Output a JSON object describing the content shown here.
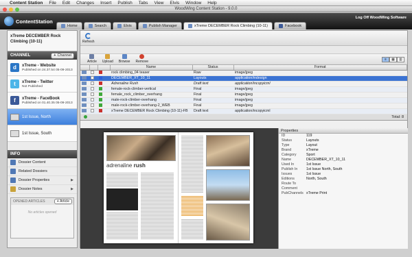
{
  "menubar": {
    "app": "Content Station",
    "items": [
      "File",
      "Edit",
      "Changes",
      "Insert",
      "Publish",
      "Tabs",
      "View",
      "Elvis",
      "Window",
      "Help"
    ]
  },
  "window": {
    "title": "WoodWing Content Station - 9.0.0"
  },
  "header": {
    "logo_text": "ContentStation",
    "logoff": "Log Off WoodWing Software",
    "tabs": [
      {
        "label": "Home"
      },
      {
        "label": "Search"
      },
      {
        "label": "Elvis"
      },
      {
        "label": "Publish Manager"
      },
      {
        "label": "xTreme DECEMBER Rock Climbing (10-11)"
      },
      {
        "label": "Facebook"
      }
    ]
  },
  "sidebar": {
    "dossier_title": "xTreme DECEMBER Rock Climbing (10-11)",
    "channel_header": "CHANNEL",
    "channel_button": "Channel",
    "channels": [
      {
        "name": "xTreme - Website",
        "status": "Published on 24.37.54 05-09-2013",
        "icon": "drupal-icon",
        "color": "#2a76c6"
      },
      {
        "name": "xTreme - Twitter",
        "status": "Not Published",
        "icon": "twitter-icon",
        "color": "#4cb5e8"
      },
      {
        "name": "xTreme - FaceBook",
        "status": "Published on 01.40.35 05-09-2013",
        "icon": "facebook-icon",
        "color": "#3b5998"
      }
    ],
    "issues": [
      {
        "name": "1st Issue, North"
      },
      {
        "name": "1st Issue, South"
      }
    ],
    "info_header": "INFO",
    "info_items": [
      {
        "label": "Dossier Content",
        "has_arrow": false
      },
      {
        "label": "Related Dossiers",
        "has_arrow": false
      },
      {
        "label": "Dossier Properties",
        "has_arrow": true
      },
      {
        "label": "Dossier Notes",
        "has_arrow": true
      }
    ],
    "opened_articles": {
      "label": "OPENED ARTICLES",
      "button": "Article",
      "empty": "No articles opened"
    }
  },
  "toolbar": {
    "refresh": "Refresh",
    "buttons": [
      {
        "label": "Article",
        "color": "#6d7fa5"
      },
      {
        "label": "Upload",
        "color": "#d9a43a"
      },
      {
        "label": "Browse",
        "color": "#5c86c6"
      },
      {
        "label": "Remove",
        "color": "#d1422f"
      }
    ]
  },
  "table": {
    "columns": [
      "Name",
      "Status",
      "Format"
    ],
    "rows": [
      {
        "name": "rock climbing_04 teaser",
        "status": "Raw",
        "format": "image/jpeg",
        "color": "#c9302c",
        "selected": false,
        "draft": false
      },
      {
        "name": "DECEMBER_XT_10_11",
        "status": "Layouts",
        "format": "application/indesign",
        "color": "#2f62d8",
        "selected": true,
        "draft": false
      },
      {
        "name": "Adrenaline Rush",
        "status": "Draft text",
        "format": "application/incopyicml",
        "color": "#c9302c",
        "selected": false,
        "draft": true
      },
      {
        "name": "female-rock-climber-vertical",
        "status": "Final",
        "format": "image/jpeg",
        "color": "#3ea83a",
        "selected": false,
        "draft": false
      },
      {
        "name": "female_rock_climber_overhang",
        "status": "Final",
        "format": "image/jpeg",
        "color": "#3ea83a",
        "selected": false,
        "draft": false
      },
      {
        "name": "male-rock-climber-overhang",
        "status": "Final",
        "format": "image/jpeg",
        "color": "#3ea83a",
        "selected": false,
        "draft": false
      },
      {
        "name": "male-rock-climber-overhang-2_WEB",
        "status": "Final",
        "format": "image/jpeg",
        "color": "#3ea83a",
        "selected": false,
        "draft": false
      },
      {
        "name": "xTreme DECEMBER Rock Climbing (10-11)-FB",
        "status": "Draft text",
        "format": "application/incopyicml",
        "color": "#c9302c",
        "selected": false,
        "draft": false
      }
    ],
    "total_label": "Total: 8"
  },
  "preview": {
    "article_title_a": "adrenaline",
    "article_title_b": "rush"
  },
  "properties": {
    "header": "Properties",
    "rows": [
      {
        "k": "ID",
        "v": "119"
      },
      {
        "k": "Status",
        "v": "Layouts"
      },
      {
        "k": "Type",
        "v": "Layout"
      },
      {
        "k": "Brand",
        "v": "xTreme"
      },
      {
        "k": "Category",
        "v": "Sport"
      },
      {
        "k": "Name",
        "v": "DECEMBER_XT_10_11"
      },
      {
        "k": "Used In",
        "v": "1st Issue"
      },
      {
        "k": "Publish In",
        "v": "1st Issue North, South"
      },
      {
        "k": "Issues",
        "v": "1st Issue"
      },
      {
        "k": "Editions",
        "v": "North, South"
      },
      {
        "k": "Route To",
        "v": ""
      },
      {
        "k": "Comment",
        "v": ""
      },
      {
        "k": "PubChannels",
        "v": "xTreme Print"
      }
    ]
  }
}
